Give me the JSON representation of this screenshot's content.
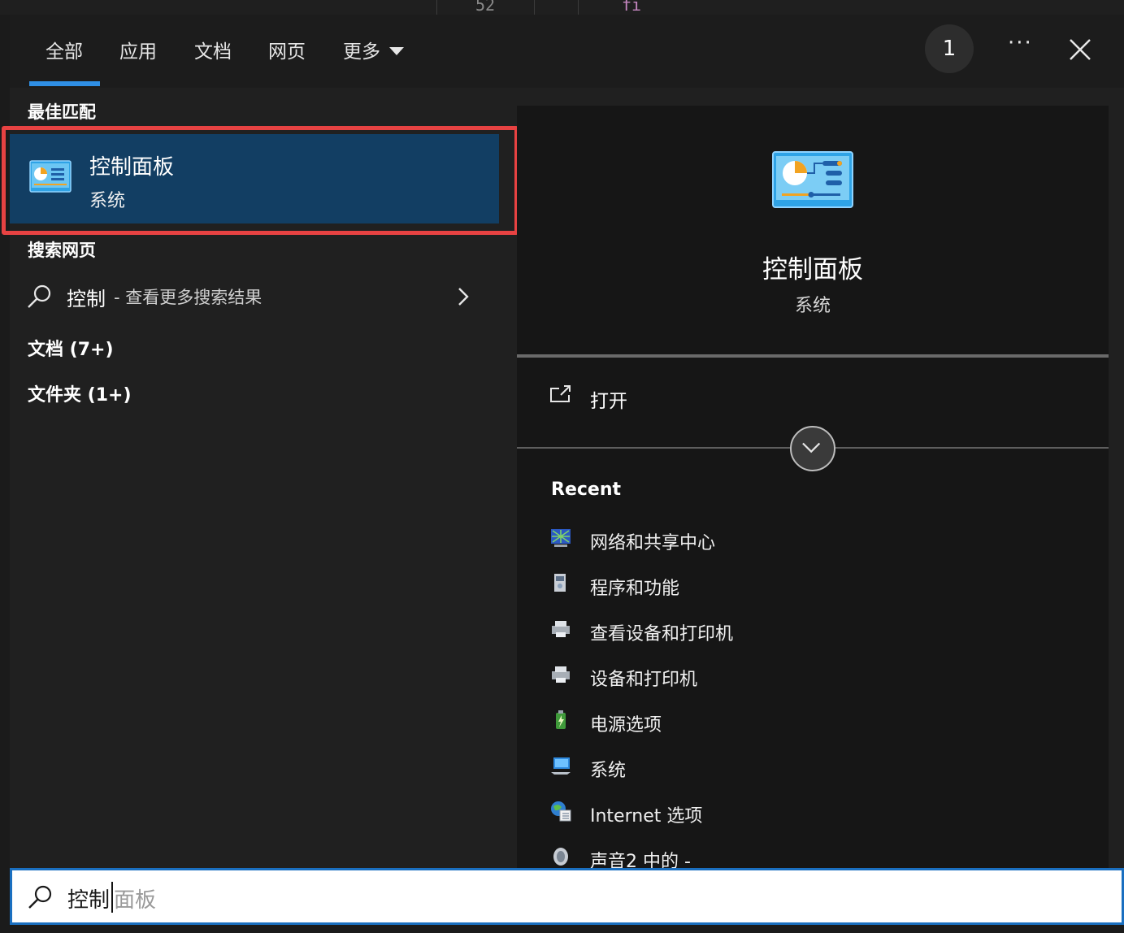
{
  "background_editor": {
    "line_number": "52",
    "keyword": "fi"
  },
  "tabs": [
    {
      "label": "全部",
      "selected": true
    },
    {
      "label": "应用"
    },
    {
      "label": "文档"
    },
    {
      "label": "网页"
    },
    {
      "label": "更多"
    }
  ],
  "header": {
    "badge_count": "1",
    "more_options": "···"
  },
  "best_match": {
    "section_label": "最佳匹配",
    "title": "控制面板",
    "subtitle": "系统"
  },
  "web_search": {
    "section_label": "搜索网页",
    "query": "控制",
    "hint": "- 查看更多搜索结果"
  },
  "groups": [
    {
      "label": "文档 (7+)"
    },
    {
      "label": "文件夹 (1+)"
    }
  ],
  "preview": {
    "title": "控制面板",
    "subtitle": "系统",
    "open_label": "打开",
    "recent_heading": "Recent",
    "recent_items": [
      {
        "label": "网络和共享中心",
        "icon": "network-icon"
      },
      {
        "label": "程序和功能",
        "icon": "programs-icon"
      },
      {
        "label": "查看设备和打印机",
        "icon": "printer-icon"
      },
      {
        "label": "设备和打印机",
        "icon": "printer-icon"
      },
      {
        "label": "电源选项",
        "icon": "power-icon"
      },
      {
        "label": "系统",
        "icon": "system-icon"
      },
      {
        "label": "Internet 选项",
        "icon": "internet-icon"
      },
      {
        "label": "声音2 中的 -",
        "icon": "sound-icon"
      }
    ]
  },
  "search": {
    "typed": "控制",
    "suggestion": "面板"
  },
  "colors": {
    "accent": "#2f8fe5",
    "highlight_border": "#e74242",
    "selection_bg": "#123e63"
  }
}
